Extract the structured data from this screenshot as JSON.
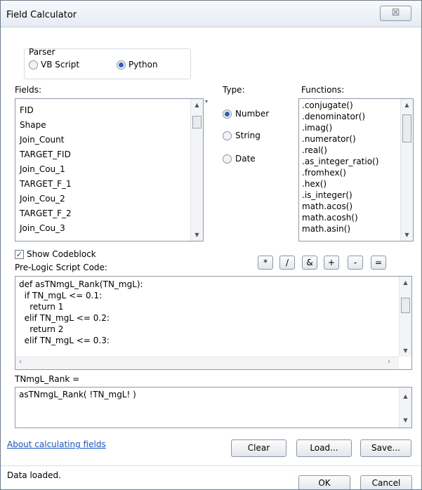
{
  "window": {
    "title": "Field Calculator",
    "close_label": "☒"
  },
  "parser": {
    "label": "Parser",
    "options": [
      {
        "label": "VB Script",
        "selected": false
      },
      {
        "label": "Python",
        "selected": true
      }
    ]
  },
  "fields": {
    "label": "Fields:",
    "items": [
      "FID",
      "Shape",
      "Join_Count",
      "TARGET_FID",
      "Join_Cou_1",
      "TARGET_F_1",
      "Join_Cou_2",
      "TARGET_F_2",
      "Join_Cou_3"
    ]
  },
  "type": {
    "label": "Type:",
    "options": [
      {
        "label": "Number",
        "selected": true
      },
      {
        "label": "String",
        "selected": false
      },
      {
        "label": "Date",
        "selected": false
      }
    ]
  },
  "functions": {
    "label": "Functions:",
    "items": [
      ".conjugate()",
      ".denominator()",
      ".imag()",
      ".numerator()",
      ".real()",
      ".as_integer_ratio()",
      ".fromhex()",
      ".hex()",
      ".is_integer()",
      "math.acos()",
      "math.acosh()",
      "math.asin()"
    ]
  },
  "show_codeblock": {
    "label": "Show Codeblock",
    "checked": true
  },
  "operators": [
    "*",
    "/",
    "&",
    "+",
    "-",
    "="
  ],
  "prelogic": {
    "label": "Pre-Logic Script Code:",
    "lines": [
      "def asTNmgL_Rank(TN_mgL):",
      "  if TN_mgL <= 0.1:",
      "    return 1",
      "  elif TN_mgL <= 0.2:",
      "    return 2",
      "  elif TN_mgL <= 0.3:"
    ]
  },
  "expression": {
    "label": "TNmgL_Rank =",
    "value": "asTNmgL_Rank( !TN_mgL! )"
  },
  "about_link": "About calculating fields",
  "buttons": {
    "clear": "Clear",
    "load": "Load...",
    "save": "Save...",
    "ok": "OK",
    "cancel": "Cancel"
  },
  "status": "Data loaded."
}
